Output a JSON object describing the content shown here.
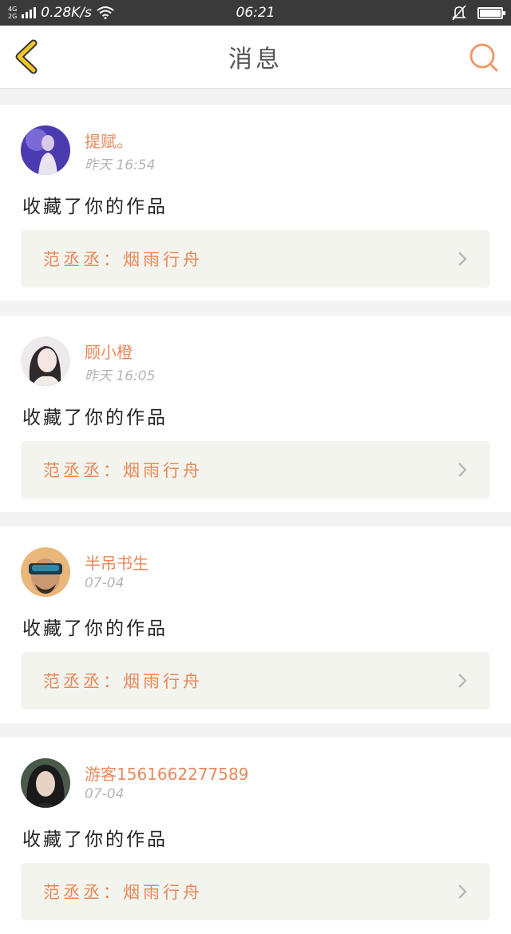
{
  "status": {
    "net_top": "4G",
    "net_bottom": "2G",
    "speed": "0.28K/s",
    "time": "06:21"
  },
  "header": {
    "title": "消息",
    "back_icon": "chevron-left-icon",
    "search_icon": "search-icon"
  },
  "colors": {
    "accent": "#e8885a",
    "back_icon": "#f0c62a"
  },
  "messages": [
    {
      "name": "提赋。",
      "time": "昨天 16:54",
      "action": "收藏了你的作品",
      "work": "范丞丞：烟雨行舟"
    },
    {
      "name": "顾小橙",
      "time": "昨天 16:05",
      "action": "收藏了你的作品",
      "work": "范丞丞：烟雨行舟"
    },
    {
      "name": "半吊书生",
      "time": "07-04",
      "action": "收藏了你的作品",
      "work": "范丞丞：烟雨行舟"
    },
    {
      "name": "游客156166227758​9",
      "time": "07-04",
      "action": "收藏了你的作品",
      "work": "范丞丞：烟雨行舟"
    }
  ]
}
